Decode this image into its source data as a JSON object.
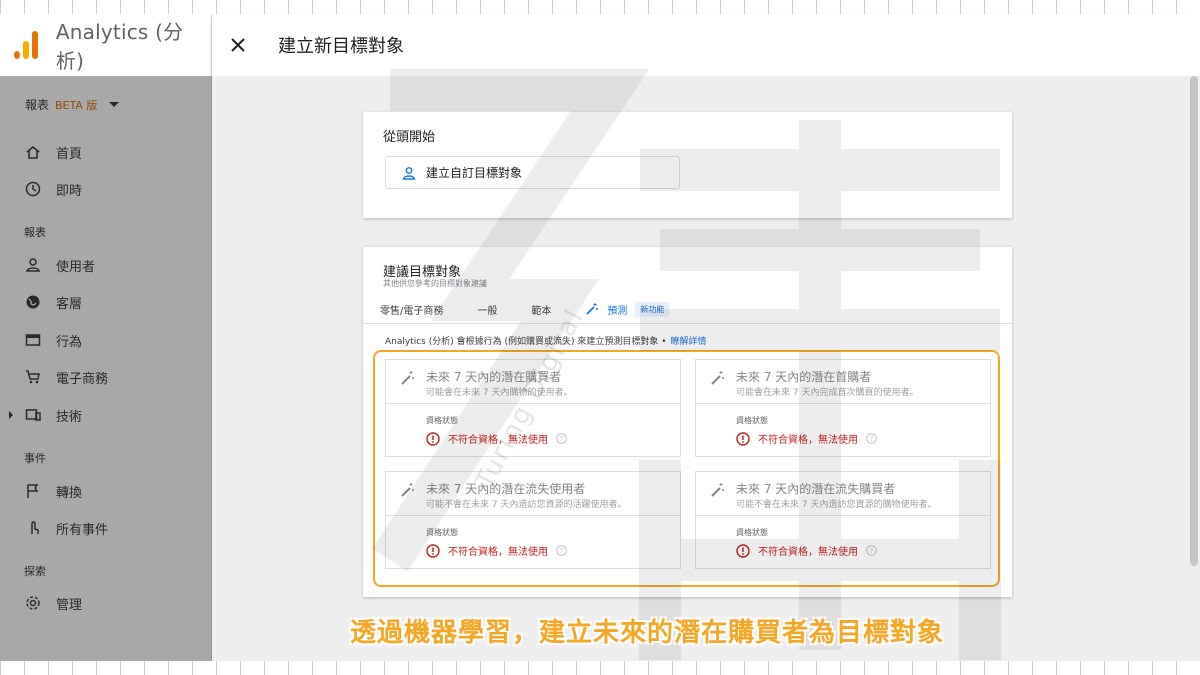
{
  "app": {
    "title": "Analytics (分析)"
  },
  "header": {
    "title": "建立新目標對象"
  },
  "sidebar": {
    "report_selector": {
      "label": "報表",
      "badge": "BETA 版"
    },
    "items": [
      {
        "label": "首頁",
        "icon": "home-icon"
      },
      {
        "label": "即時",
        "icon": "clock-icon"
      },
      {
        "section": "報表"
      },
      {
        "label": "使用者",
        "icon": "person-icon"
      },
      {
        "label": "客層",
        "icon": "globe-icon"
      },
      {
        "label": "行為",
        "icon": "browser-window-icon"
      },
      {
        "label": "電子商務",
        "icon": "cart-icon"
      },
      {
        "label": "技術",
        "icon": "devices-icon"
      },
      {
        "section": "事件"
      },
      {
        "label": "轉換",
        "icon": "flag-icon"
      },
      {
        "label": "所有事件",
        "icon": "touch-icon"
      },
      {
        "section": "探索"
      },
      {
        "label": "管理",
        "icon": "gear-icon"
      }
    ]
  },
  "start_card": {
    "title": "從頭開始",
    "custom_button": "建立自訂目標對象"
  },
  "suggest_card": {
    "title": "建議目標對象",
    "subtitle": "其他供您參考的目標對象建議",
    "tabs": [
      "零售/電子商務",
      "一般",
      "範本",
      "預測"
    ],
    "new_badge": "新功能",
    "intro": "Analytics (分析) 會根據行為 (例如購買或流失) 來建立預測目標對象 •",
    "learn_more": "瞭解詳情",
    "tiles": [
      {
        "title": "未來 7 天內的潛在購買者",
        "desc": "可能會在未來 7 天內購物的使用者。",
        "status_label": "資格狀態",
        "status": "不符合資格，無法使用"
      },
      {
        "title": "未來 7 天內的潛在首購者",
        "desc": "可能會在未來 7 天內完成首次購買的使用者。",
        "status_label": "資格狀態",
        "status": "不符合資格，無法使用"
      },
      {
        "title": "未來 7 天內的潛在流失使用者",
        "desc": "可能不會在未來 7 天內造訪您資源的活躍使用者。",
        "status_label": "資格狀態",
        "status": "不符合資格，無法使用"
      },
      {
        "title": "未來 7 天內的潛在流失購買者",
        "desc": "可能不會在未來 7 天內造訪您資源的購物使用者。",
        "status_label": "資格狀態",
        "status": "不符合資格，無法使用"
      }
    ]
  },
  "watermark": {
    "text": "Turing Digital"
  },
  "caption": "透過機器學習，建立未來的潛在購買者為目標對象",
  "colors": {
    "accent": "#1a73e8",
    "highlight": "#f5a623",
    "error": "#c5221f",
    "logo": [
      "#f9ab00",
      "#e37400",
      "#e37400"
    ]
  }
}
